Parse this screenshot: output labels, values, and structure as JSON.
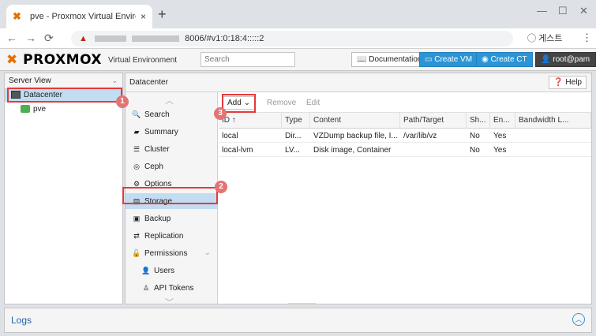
{
  "browser": {
    "tab_title": "pve - Proxmox Virtual Environm",
    "tab_close": "×",
    "new_tab": "+",
    "url_text": "8006/#v1:0:18:4:::::2",
    "profile_label": "게스트",
    "colors": {
      "favicon": "#e57000",
      "chrome_bg": "#dee1e6"
    }
  },
  "header": {
    "logo_text": "PROXMOX",
    "ve_label": "Virtual Environment",
    "search_placeholder": "Search",
    "documentation_label": "Documentation",
    "create_vm_label": "Create VM",
    "create_ct_label": "Create CT",
    "user_label": "root@pam",
    "colors": {
      "brand": "#e57000",
      "button_blue": "#2b95d6"
    }
  },
  "tree": {
    "view_label": "Server View",
    "items": [
      {
        "label": "Datacenter",
        "icon": "datacenter-icon",
        "selected": true
      },
      {
        "label": "pve",
        "icon": "node-icon",
        "selected": false
      }
    ]
  },
  "content": {
    "title": "Datacenter",
    "help_label": "Help",
    "menu": [
      {
        "label": "Search",
        "icon": "search-icon"
      },
      {
        "label": "Summary",
        "icon": "book-icon"
      },
      {
        "label": "Cluster",
        "icon": "server-icon"
      },
      {
        "label": "Ceph",
        "icon": "ceph-icon"
      },
      {
        "label": "Options",
        "icon": "gear-icon"
      },
      {
        "label": "Storage",
        "icon": "database-icon",
        "active": true
      },
      {
        "label": "Backup",
        "icon": "floppy-icon"
      },
      {
        "label": "Replication",
        "icon": "retweet-icon"
      },
      {
        "label": "Permissions",
        "icon": "unlock-icon"
      },
      {
        "label": "Users",
        "icon": "user-icon"
      },
      {
        "label": "API Tokens",
        "icon": "user-outline-icon"
      }
    ],
    "toolbar": {
      "add": "Add",
      "remove": "Remove",
      "edit": "Edit"
    },
    "columns": [
      "ID ↑",
      "Type",
      "Content",
      "Path/Target",
      "Sh...",
      "En...",
      "Bandwidth L..."
    ],
    "rows": [
      [
        "local",
        "Dir...",
        "VZDump backup file, I...",
        "/var/lib/vz",
        "No",
        "Yes",
        ""
      ],
      [
        "local-lvm",
        "LV...",
        "Disk image, Container",
        "",
        "No",
        "Yes",
        ""
      ]
    ]
  },
  "annotations": {
    "badges": [
      "1",
      "2",
      "3"
    ],
    "color": "#e53939"
  },
  "logs": {
    "label": "Logs"
  }
}
